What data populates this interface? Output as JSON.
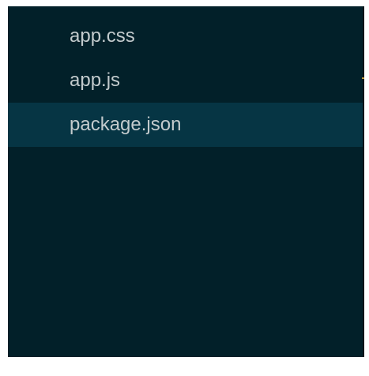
{
  "explorer": {
    "files": [
      {
        "name": "app.css",
        "selected": false
      },
      {
        "name": "app.js",
        "selected": false
      },
      {
        "name": "package.json",
        "selected": true
      }
    ]
  },
  "colors": {
    "panel_background": "#022029",
    "selected_row": "#063544",
    "file_text": "#c3cbcd",
    "page_background": "#ffffff",
    "edge_tick": "#c49b3f"
  }
}
